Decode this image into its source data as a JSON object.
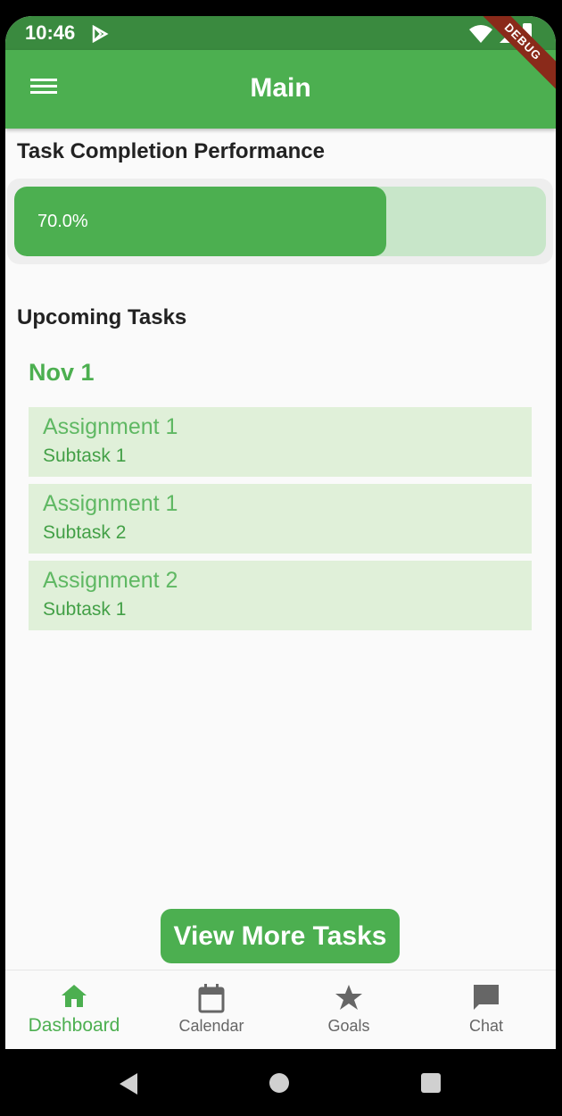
{
  "status_bar": {
    "time": "10:46",
    "debug_label": "DEBUG"
  },
  "app_bar": {
    "title": "Main"
  },
  "performance": {
    "heading": "Task Completion Performance",
    "value": 0.7,
    "label": "70.0%"
  },
  "upcoming": {
    "heading": "Upcoming Tasks",
    "date": "Nov 1",
    "tasks": [
      {
        "title": "Assignment 1",
        "subtask": "Subtask 1"
      },
      {
        "title": "Assignment 1",
        "subtask": "Subtask 2"
      },
      {
        "title": "Assignment 2",
        "subtask": "Subtask 1"
      }
    ]
  },
  "view_more_label": "View More Tasks",
  "bottom_nav": [
    {
      "label": "Dashboard",
      "icon": "home-icon",
      "active": true
    },
    {
      "label": "Calendar",
      "icon": "calendar-icon",
      "active": false
    },
    {
      "label": "Goals",
      "icon": "star-icon",
      "active": false
    },
    {
      "label": "Chat",
      "icon": "chat-icon",
      "active": false
    }
  ],
  "colors": {
    "primary": "#4caf50",
    "status_bar": "#3a8a3f",
    "track": "#c8e6c9",
    "task_bg": "#e0f0d9"
  }
}
